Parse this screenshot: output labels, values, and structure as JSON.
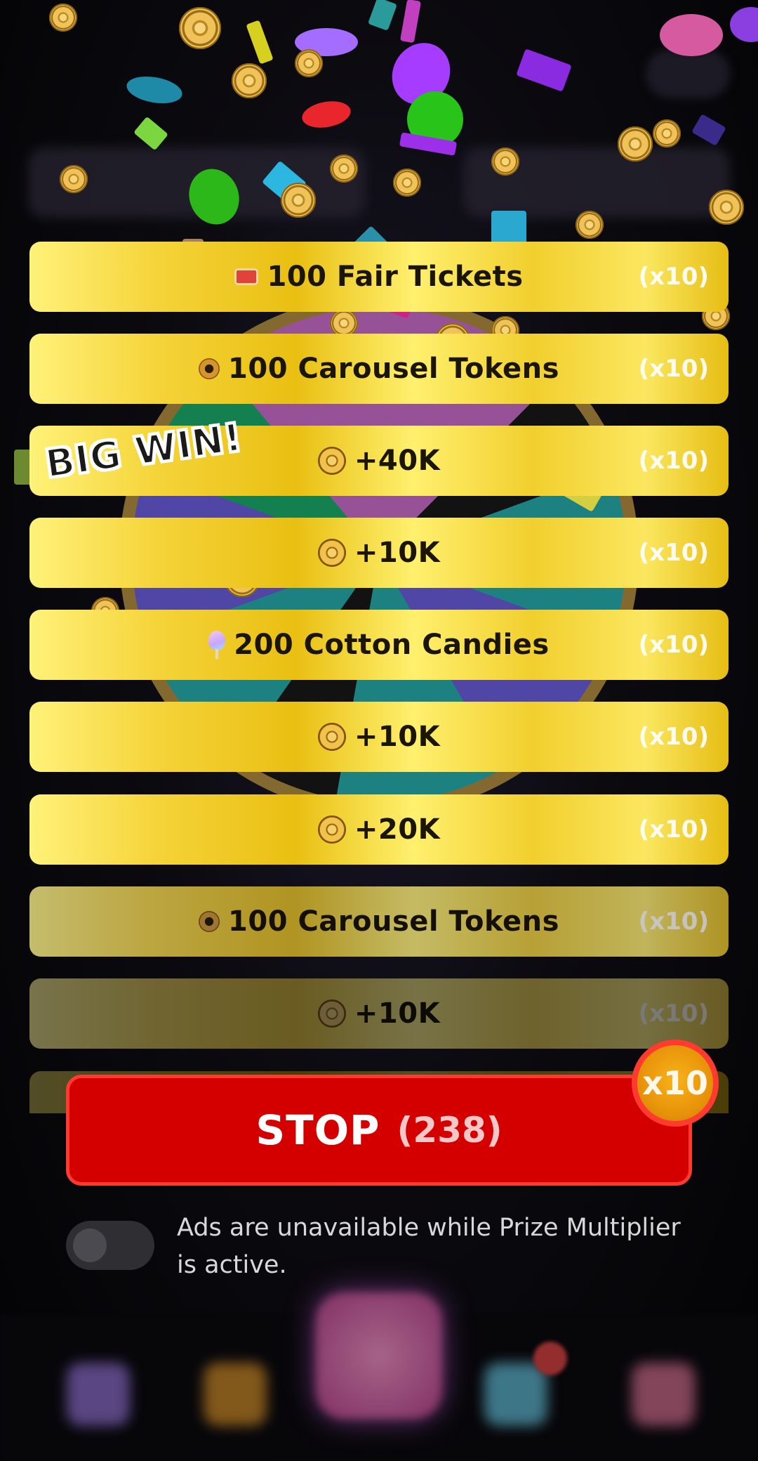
{
  "rewards": [
    {
      "icon": "ticket-icon",
      "label": "100 Fair Tickets",
      "multiplier": "(x10)"
    },
    {
      "icon": "carousel-token-icon",
      "label": "100 Carousel Tokens",
      "multiplier": "(x10)"
    },
    {
      "icon": "coin-icon",
      "label": "+40K",
      "multiplier": "(x10)"
    },
    {
      "icon": "coin-icon",
      "label": "+10K",
      "multiplier": "(x10)"
    },
    {
      "icon": "cotton-candy-icon",
      "label": "200 Cotton Candies",
      "multiplier": "(x10)"
    },
    {
      "icon": "coin-icon",
      "label": "+10K",
      "multiplier": "(x10)"
    },
    {
      "icon": "coin-icon",
      "label": "+20K",
      "multiplier": "(x10)"
    },
    {
      "icon": "carousel-token-icon",
      "label": "100 Carousel Tokens",
      "multiplier": "(x10)"
    },
    {
      "icon": "coin-icon",
      "label": "+10K",
      "multiplier": "(x10)"
    }
  ],
  "big_win": "BIG WIN!",
  "stop_button": {
    "label": "STOP",
    "count": "(238)"
  },
  "multiplier_badge": "x10",
  "ads_toggle": {
    "state": "off",
    "text": "Ads are unavailable while Prize Multiplier is active."
  },
  "colors": {
    "row_gold": "#f2cf2a",
    "stop_red": "#d40000",
    "badge_orange": "#e8940a"
  }
}
